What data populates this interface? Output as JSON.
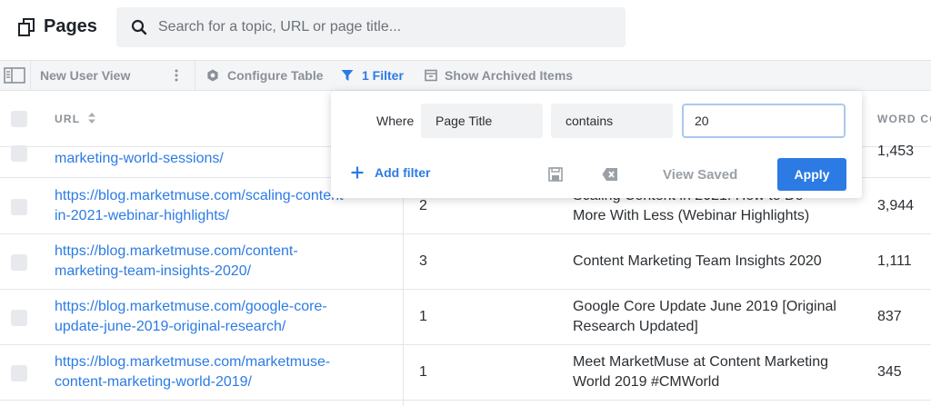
{
  "header": {
    "title": "Pages",
    "search_placeholder": "Search for a topic, URL or page title..."
  },
  "toolbar": {
    "view_label": "New User View",
    "configure_label": "Configure Table",
    "filter_label": "1 Filter",
    "archived_label": "Show Archived Items"
  },
  "table": {
    "headers": {
      "url": "URL",
      "word_count": "WORD CO"
    },
    "rows": [
      {
        "url_line1": "marketing-world-sessions/",
        "url_line2": "",
        "col2": "",
        "title1": "",
        "title2": "",
        "words": "1,453"
      },
      {
        "url_line1": "https://blog.marketmuse.com/scaling-content-",
        "url_line2": "in-2021-webinar-highlights/",
        "col2": "2",
        "title1": "Scaling Content in 2021: How to Do",
        "title2": "More With Less (Webinar Highlights)",
        "words": "3,944"
      },
      {
        "url_line1": "https://blog.marketmuse.com/content-",
        "url_line2": "marketing-team-insights-2020/",
        "col2": "3",
        "title1": "Content Marketing Team Insights 2020",
        "title2": "",
        "words": "1,111"
      },
      {
        "url_line1": "https://blog.marketmuse.com/google-core-",
        "url_line2": "update-june-2019-original-research/",
        "col2": "1",
        "title1": "Google Core Update June 2019 [Original",
        "title2": "Research Updated]",
        "words": "837"
      },
      {
        "url_line1": "https://blog.marketmuse.com/marketmuse-",
        "url_line2": "content-marketing-world-2019/",
        "col2": "1",
        "title1": "Meet MarketMuse at Content Marketing",
        "title2": "World 2019 #CMWorld",
        "words": "345"
      }
    ]
  },
  "filter": {
    "where_label": "Where",
    "field_value": "Page Title",
    "operator_value": "contains",
    "input_value": "20",
    "add_filter_label": "Add filter",
    "view_saved_label": "View Saved",
    "apply_label": "Apply"
  },
  "colors": {
    "accent": "#2c7be5",
    "muted": "#8a9097"
  }
}
